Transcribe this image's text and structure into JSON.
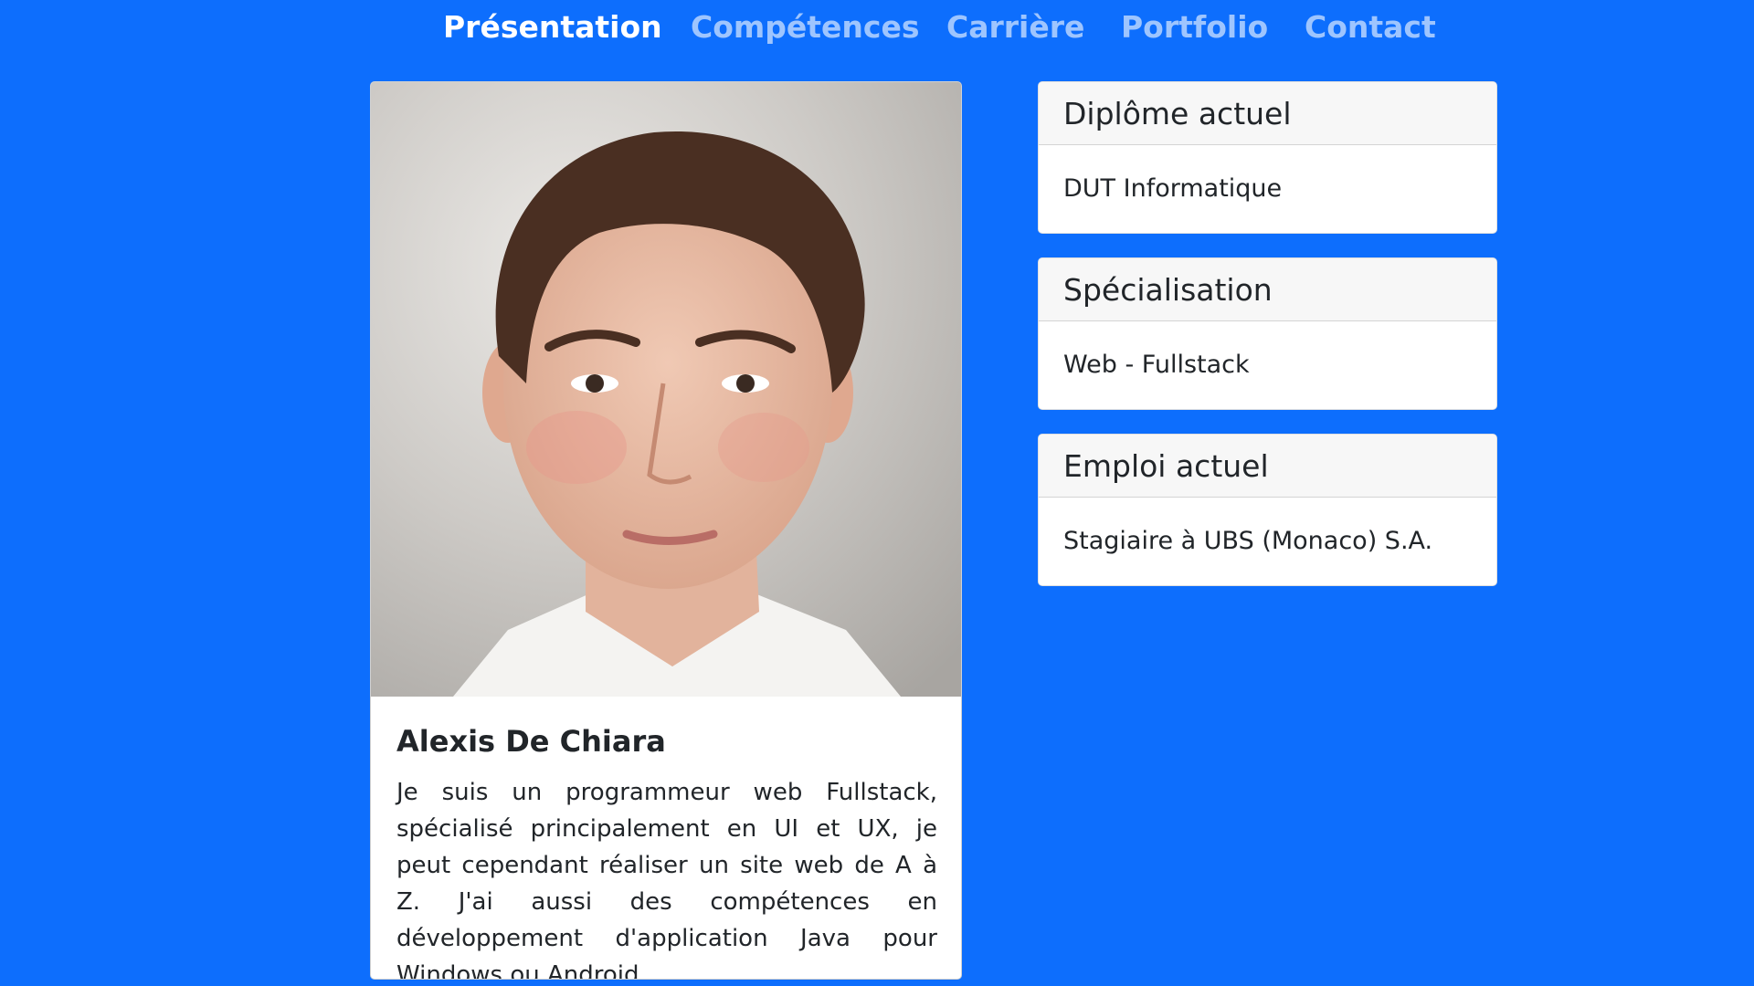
{
  "nav": {
    "items": [
      {
        "label": "Présentation",
        "active": true
      },
      {
        "label": "Compétences",
        "active": false
      },
      {
        "label": "Carrière",
        "active": false
      },
      {
        "label": "Portfolio",
        "active": false
      },
      {
        "label": "Contact",
        "active": false
      }
    ]
  },
  "profile": {
    "name": "Alexis De Chiara",
    "description": "Je suis un programmeur web Fullstack, spécialisé principalement en UI et UX, je peut cependant réaliser un site web de A à Z. J'ai aussi des compétences en développement d'application Java pour Windows ou Android."
  },
  "info_cards": [
    {
      "header": "Diplôme actuel",
      "body": "DUT Informatique"
    },
    {
      "header": "Spécialisation",
      "body": "Web - Fullstack"
    },
    {
      "header": "Emploi actuel",
      "body": "Stagiaire à UBS (Monaco) S.A."
    }
  ],
  "colors": {
    "background": "#0d6efd",
    "nav_active": "#ffffff",
    "nav_inactive": "#9ec5fe",
    "card_header_bg": "#f7f7f7"
  }
}
